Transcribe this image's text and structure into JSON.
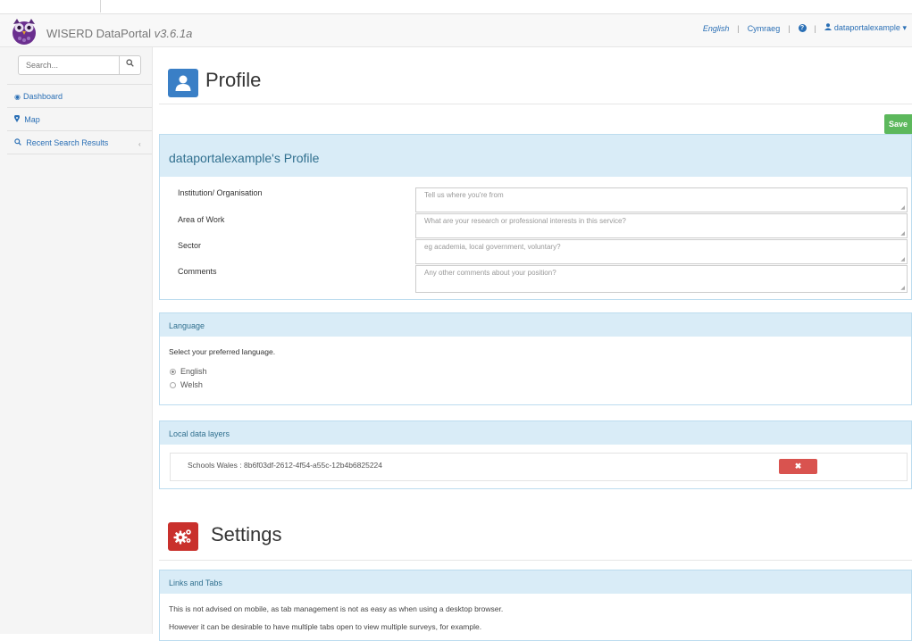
{
  "navbar": {
    "brand": "WISERD DataPortal",
    "version": "v3.6.1a",
    "lang_english": "English",
    "lang_welsh": "Cymraeg",
    "separator": "|",
    "username": "dataportalexample"
  },
  "sidebar": {
    "search_placeholder": "Search...",
    "items": [
      {
        "label": "Dashboard",
        "icon": "dashboard-icon"
      },
      {
        "label": "Map",
        "icon": "map-marker-icon"
      },
      {
        "label": "Recent Search Results",
        "icon": "search-icon"
      }
    ]
  },
  "profile": {
    "title": "Profile",
    "save_label": "Save",
    "panel_title": "dataportalexample's Profile",
    "fields": [
      {
        "label": "Institution/ Organisation",
        "placeholder": "Tell us where you're from"
      },
      {
        "label": "Area of Work",
        "placeholder": "What are your research or professional interests in this service?"
      },
      {
        "label": "Sector",
        "placeholder": "eg academia, local government, voluntary?"
      },
      {
        "label": "Comments",
        "placeholder": "Any other comments about your position?"
      }
    ]
  },
  "language": {
    "heading": "Language",
    "prompt": "Select your preferred language.",
    "options": [
      {
        "label": "English",
        "selected": true
      },
      {
        "label": "Welsh",
        "selected": false
      }
    ]
  },
  "layers": {
    "heading": "Local data layers",
    "items": [
      {
        "label": "Schools Wales : 8b6f03df-2612-4f54-a55c-12b4b6825224"
      }
    ],
    "delete_glyph": "✖"
  },
  "settings": {
    "title": "Settings",
    "panel_title": "Links and Tabs",
    "lines": [
      "This is not advised on mobile, as tab management is not as easy as when using a desktop browser.",
      "However it can be desirable to have multiple tabs open to view multiple surveys, for example."
    ]
  },
  "colors": {
    "link": "#2a6fb5",
    "panel_heading": "#d9ecf7",
    "save": "#5cb85c",
    "danger": "#d9534f",
    "profile_icon": "#3a7fc6",
    "settings_icon": "#c9302c"
  }
}
